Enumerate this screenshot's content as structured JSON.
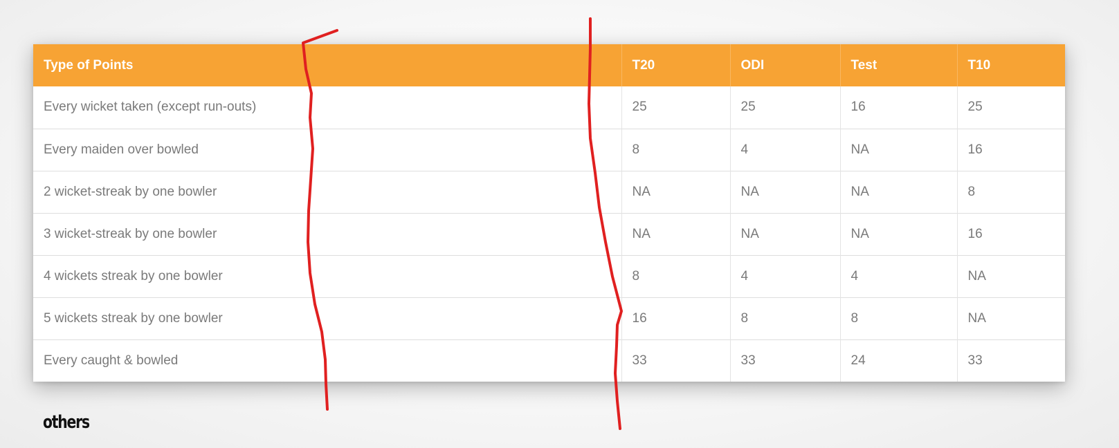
{
  "points_table": {
    "headers": [
      "Type of Points",
      "T20",
      "ODI",
      "Test",
      "T10"
    ],
    "rows": [
      [
        "Every wicket taken (except run-outs)",
        "25",
        "25",
        "16",
        "25"
      ],
      [
        "Every maiden over bowled",
        "8",
        "4",
        "NA",
        "16"
      ],
      [
        "2 wicket-streak by one bowler",
        "NA",
        "NA",
        "NA",
        "8"
      ],
      [
        "3 wicket-streak by one bowler",
        "NA",
        "NA",
        "NA",
        "16"
      ],
      [
        "4 wickets streak by one bowler",
        "8",
        "4",
        "4",
        "NA"
      ],
      [
        "5 wickets streak by one bowler",
        "16",
        "8",
        "8",
        "NA"
      ],
      [
        "Every caught & bowled",
        "33",
        "33",
        "24",
        "33"
      ]
    ]
  },
  "section": {
    "heading": "others"
  },
  "colors": {
    "header_bg": "#f7a334",
    "header_text": "#ffffff",
    "cell_text": "#7a7a7a",
    "annotation_stroke": "#e02020"
  }
}
